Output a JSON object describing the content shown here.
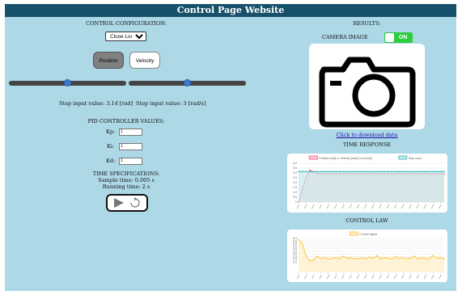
{
  "title": "Control Page Website",
  "control": {
    "heading": "CONTROL CONFIGURATION:",
    "mode_selected": "Close Loop",
    "buttons": {
      "position": "Position",
      "velocity": "Velocity"
    },
    "step_position_label": "Step input value: 3.14 [rad]",
    "step_velocity_label": "Step input value: 3 [rad/s]",
    "position_slider_fraction": 0.5,
    "velocity_slider_fraction": 0.5
  },
  "pid": {
    "heading": "PID CONTROLLER VALUES:",
    "kp_label": "Kp:",
    "kp_value": "1",
    "ki_label": "Ki:",
    "ki_value": "1",
    "kd_label": "Kd:",
    "kd_value": "1"
  },
  "time": {
    "heading": "TIME SPECIFICATIONS:",
    "sample": "Sample time: 0.005 s",
    "running": "Running time: 2 s"
  },
  "results": {
    "heading": "RESULTS:",
    "camera_label": "CAMERA IMAGE",
    "toggle_text": "ON",
    "toggle_on": true,
    "download_link": "Click to download data",
    "time_response_heading": "TIME RESPONSE",
    "control_law_heading": "CONTROL LAW"
  },
  "chart_data": [
    {
      "type": "line",
      "legend": [
        "Position [rad] or Velocity [rad/s] vs time[s]",
        "Step Input"
      ],
      "legend_placement": "top",
      "ylim": [
        0,
        4
      ],
      "y_ticks": [
        "4.0",
        "3.5",
        "3.0",
        "2.5",
        "2.0",
        "1.5",
        "1.0",
        "0.5",
        "0"
      ],
      "series": [
        {
          "name": "Position [rad] or Velocity [rad/s] vs time[s]",
          "color": "#ff6384",
          "fill": "#ffd1db",
          "values": [
            0,
            1.2,
            2.5,
            3.3,
            3.1,
            2.95,
            2.9,
            2.95,
            2.9,
            2.9,
            2.95,
            2.9,
            2.9,
            2.95,
            2.9,
            2.9,
            2.9,
            2.95,
            2.9,
            2.9,
            2.95,
            2.9,
            2.9,
            2.9,
            2.95,
            2.9,
            2.9,
            2.95,
            2.9,
            2.9,
            2.9,
            2.95,
            2.9,
            2.9,
            2.95,
            2.9,
            2.9,
            2.9,
            2.95,
            2.9
          ]
        },
        {
          "name": "Step Input",
          "color": "#4bc0c0",
          "fill": "#c6e9e9",
          "values": [
            3.14,
            3.14,
            3.14,
            3.14,
            3.14,
            3.14,
            3.14,
            3.14,
            3.14,
            3.14,
            3.14,
            3.14,
            3.14,
            3.14,
            3.14,
            3.14,
            3.14,
            3.14,
            3.14,
            3.14,
            3.14,
            3.14,
            3.14,
            3.14,
            3.14,
            3.14,
            3.14,
            3.14,
            3.14,
            3.14,
            3.14,
            3.14,
            3.14,
            3.14,
            3.14,
            3.14,
            3.14,
            3.14,
            3.14,
            3.14
          ]
        }
      ]
    },
    {
      "type": "line",
      "legend": [
        "Control signal"
      ],
      "legend_placement": "top",
      "ylim": [
        0,
        6.5
      ],
      "y_ticks": [
        "6.5",
        "6.0",
        "5.5",
        "5.0",
        "4.5",
        "4.0",
        "3.5",
        "3.0",
        "2.5",
        "2.0"
      ],
      "series": [
        {
          "name": "Control signal",
          "color": "#ffcd56",
          "fill": "#fff0c8",
          "values": [
            6.3,
            5.5,
            3.2,
            2.2,
            2.4,
            3.1,
            2.7,
            2.8,
            2.6,
            2.7,
            2.8,
            2.6,
            3.1,
            2.7,
            2.8,
            2.6,
            2.7,
            2.8,
            2.6,
            2.9,
            2.7,
            3.2,
            2.6,
            2.8,
            2.7,
            2.6,
            3.0,
            2.7,
            2.8,
            2.6,
            2.7,
            3.1,
            2.6,
            2.8,
            2.7,
            2.6,
            3.2,
            2.7,
            2.8,
            2.6
          ]
        }
      ]
    }
  ]
}
